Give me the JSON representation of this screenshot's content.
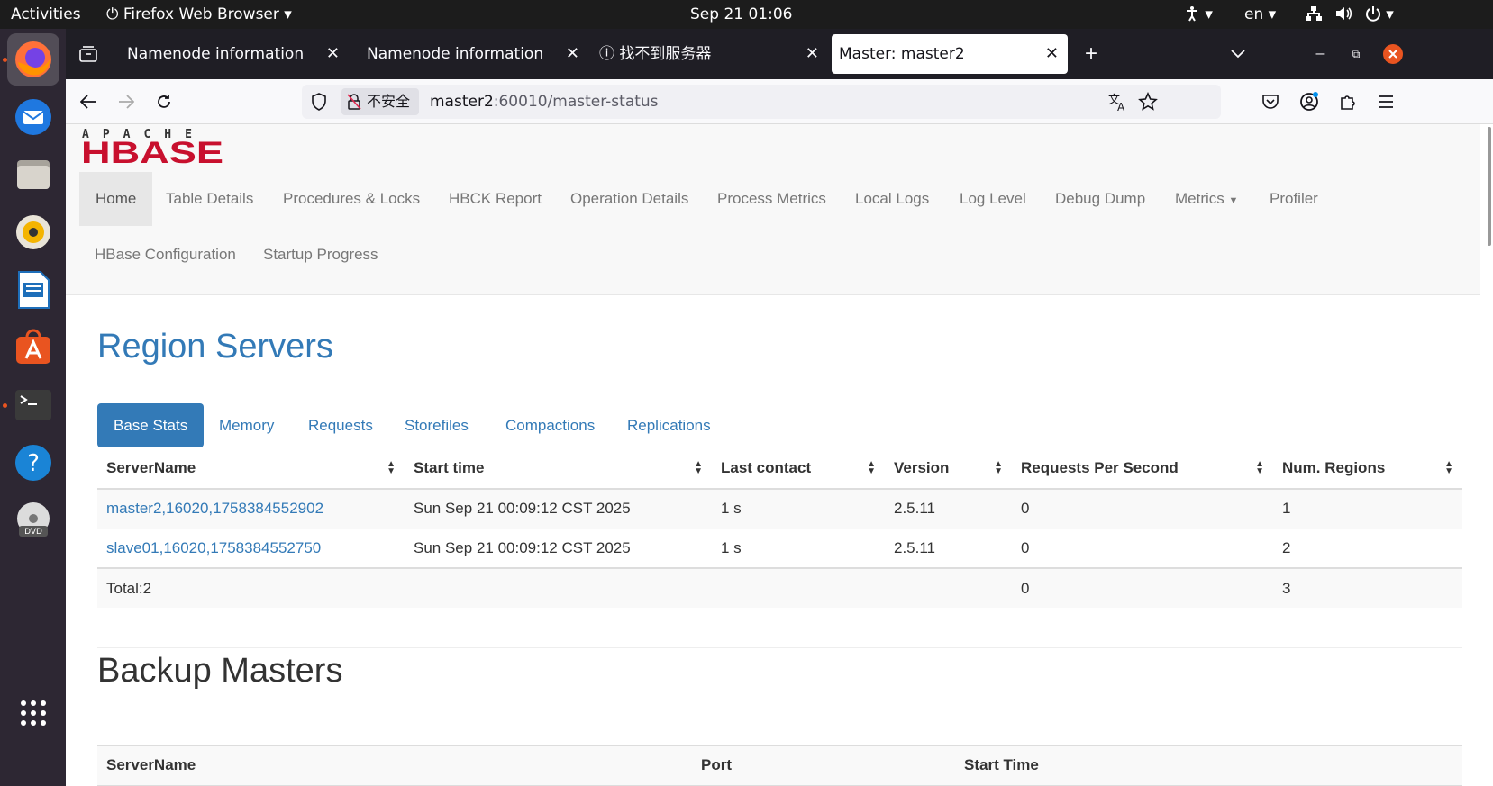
{
  "system_bar": {
    "activities": "Activities",
    "app_name": "Firefox Web Browser",
    "clock": "Sep 21  01:06",
    "language": "en"
  },
  "dock": {
    "items": [
      "firefox-icon",
      "thunderbird-icon",
      "files-icon",
      "rhythmbox-icon",
      "writer-icon",
      "app-center-icon",
      "terminal-icon",
      "help-icon",
      "dvd-icon",
      "show-apps-icon"
    ]
  },
  "browser": {
    "tabs": [
      {
        "title": "Namenode information"
      },
      {
        "title": "Namenode information"
      },
      {
        "title": "找不到服务器"
      },
      {
        "title": "Master: master2"
      }
    ],
    "security_label": "不安全",
    "url_host": "master2",
    "url_rest": ":60010/master-status"
  },
  "hbase": {
    "logo_top": "APACHE",
    "logo_main": "HBASE",
    "nav": [
      {
        "label": "Home"
      },
      {
        "label": "Table Details"
      },
      {
        "label": "Procedures & Locks"
      },
      {
        "label": "HBCK Report"
      },
      {
        "label": "Operation Details"
      },
      {
        "label": "Process Metrics"
      },
      {
        "label": "Local Logs"
      },
      {
        "label": "Log Level"
      },
      {
        "label": "Debug Dump"
      },
      {
        "label": "Metrics"
      },
      {
        "label": "Profiler"
      },
      {
        "label": "HBase Configuration"
      },
      {
        "label": "Startup Progress"
      }
    ]
  },
  "region_servers": {
    "title": "Region Servers",
    "tabs": [
      "Base Stats",
      "Memory",
      "Requests",
      "Storefiles",
      "Compactions",
      "Replications"
    ],
    "columns": [
      "ServerName",
      "Start time",
      "Last contact",
      "Version",
      "Requests Per Second",
      "Num. Regions"
    ],
    "rows": [
      {
        "server": "master2,16020,1758384552902",
        "start": "Sun Sep 21 00:09:12 CST 2025",
        "contact": "1 s",
        "version": "2.5.11",
        "rps": "0",
        "regions": "1"
      },
      {
        "server": "slave01,16020,1758384552750",
        "start": "Sun Sep 21 00:09:12 CST 2025",
        "contact": "1 s",
        "version": "2.5.11",
        "rps": "0",
        "regions": "2"
      }
    ],
    "total": {
      "label": "Total:2",
      "rps": "0",
      "regions": "3"
    }
  },
  "backup_masters": {
    "title": "Backup Masters",
    "columns": [
      "ServerName",
      "Port",
      "Start Time"
    ]
  },
  "colors": {
    "link": "#337ab7",
    "logo_red": "#c8102e",
    "accent": "#e95420"
  }
}
